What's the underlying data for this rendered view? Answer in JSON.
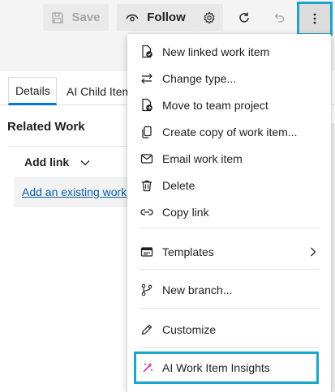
{
  "toolbar": {
    "save_label": "Save",
    "follow_label": "Follow",
    "icons": [
      "save-icon",
      "eye-icon",
      "gear-icon",
      "refresh-icon",
      "undo-icon",
      "more-vertical-icon"
    ]
  },
  "tabs": [
    {
      "label": "Details"
    },
    {
      "label": "AI Child Item"
    }
  ],
  "related_work": {
    "title": "Related Work",
    "add_link_label": "Add link",
    "existing_link_text": "Add an existing work"
  },
  "menu": {
    "items": [
      {
        "label": "New linked work item",
        "icon": "new-linked-item-icon"
      },
      {
        "label": "Change type...",
        "icon": "arrows-swap-icon"
      },
      {
        "label": "Move to team project",
        "icon": "move-document-icon"
      },
      {
        "label": "Create copy of work item...",
        "icon": "copy-icon"
      },
      {
        "label": "Email work item",
        "icon": "mail-icon"
      },
      {
        "label": "Delete",
        "icon": "trash-icon"
      },
      {
        "label": "Copy link",
        "icon": "link-icon"
      },
      {
        "label": "Templates",
        "icon": "template-icon"
      },
      {
        "label": "New branch...",
        "icon": "branch-icon"
      },
      {
        "label": "Customize",
        "icon": "pencil-icon"
      },
      {
        "label": "AI Work Item Insights",
        "icon": "ai-sparkle-icon"
      }
    ]
  },
  "colors": {
    "highlight": "#1ba5c8",
    "link": "#0a5ea8",
    "tab_accent": "#0078d4",
    "ai_icon": "#c239b3"
  }
}
